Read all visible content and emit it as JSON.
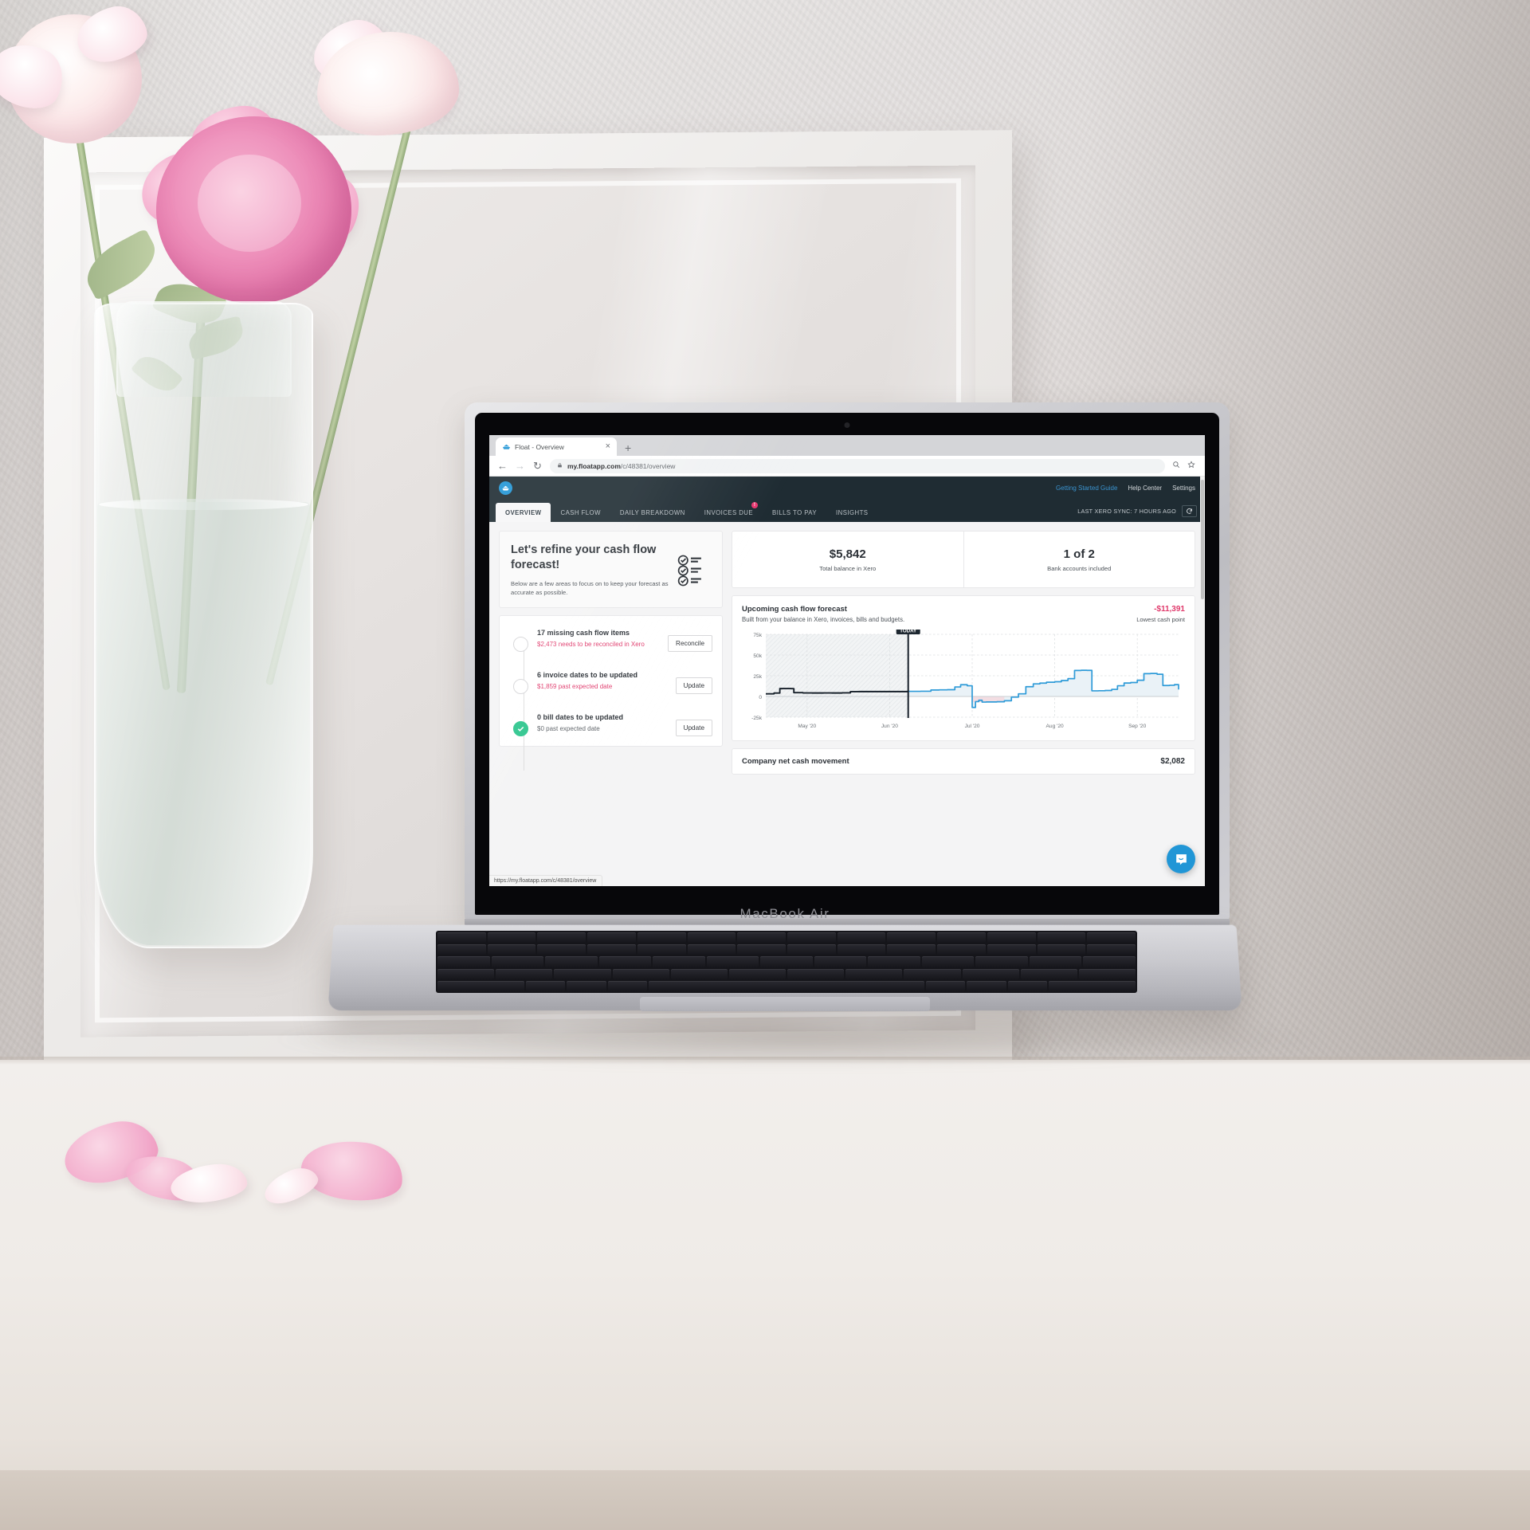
{
  "browser": {
    "tab_title": "Float - Overview",
    "tab_favicon": "float-logo-icon",
    "close_label": "×",
    "newtab_label": "+",
    "back_label": "←",
    "forward_label": "→",
    "reload_label": "↻",
    "lock_label": "🔒",
    "url_host": "my.floatapp.com",
    "url_path": "/c/48381/overview",
    "zoom_icon": "⊕",
    "star_icon": "☆",
    "status_url": "https://my.floatapp.com/c/48381/overview"
  },
  "header": {
    "logo": "float-boat-logo",
    "links": [
      {
        "label": "Getting Started Guide",
        "accent": true
      },
      {
        "label": "Help Center",
        "accent": false
      },
      {
        "label": "Settings",
        "accent": false
      }
    ]
  },
  "nav": {
    "tabs": [
      {
        "label": "OVERVIEW",
        "active": true,
        "badge": ""
      },
      {
        "label": "CASH FLOW",
        "active": false,
        "badge": ""
      },
      {
        "label": "DAILY BREAKDOWN",
        "active": false,
        "badge": ""
      },
      {
        "label": "INVOICES DUE",
        "active": false,
        "badge": "!"
      },
      {
        "label": "BILLS TO PAY",
        "active": false,
        "badge": ""
      },
      {
        "label": "INSIGHTS",
        "active": false,
        "badge": ""
      }
    ],
    "sync_text": "LAST XERO SYNC: 7 HOURS AGO",
    "sync_button_icon": "↻"
  },
  "refine": {
    "title": "Let's refine your cash flow forecast!",
    "subtitle": "Below are a few areas to focus on to keep your forecast as accurate as possible.",
    "icon": "checklist-icon"
  },
  "tasks": [
    {
      "title": "17 missing cash flow items",
      "sub": "$2,473 needs to be reconciled in Xero",
      "button": "Reconcile",
      "done": false,
      "muted": false
    },
    {
      "title": "6 invoice dates to be updated",
      "sub": "$1,859 past expected date",
      "button": "Update",
      "done": false,
      "muted": false
    },
    {
      "title": "0 bill dates to be updated",
      "sub": "$0 past expected date",
      "button": "Update",
      "done": true,
      "muted": true
    }
  ],
  "stats": [
    {
      "value": "$5,842",
      "label": "Total balance in Xero"
    },
    {
      "value": "1 of 2",
      "label": "Bank accounts included"
    }
  ],
  "forecast": {
    "title": "Upcoming cash flow forecast",
    "subtitle": "Built from your balance in Xero, invoices, bills and budgets.",
    "value": "-$11,391",
    "value_label": "Lowest cash point",
    "today_label": "TODAY"
  },
  "net_movement": {
    "title": "Company net cash movement",
    "value": "$2,082"
  },
  "intercom": {
    "icon": "chat-bubble-icon"
  },
  "colors": {
    "header_bg": "#1f2c33",
    "accent_blue": "#2196d6",
    "line_blue": "#2f9bd8",
    "alert_pink": "#e0396b",
    "success_green": "#27c48a"
  },
  "chart_data": {
    "type": "line",
    "title": "Upcoming cash flow forecast",
    "subtitle": "Built from your balance in Xero, invoices, bills and budgets.",
    "xlabel": "",
    "ylabel": "",
    "ylim": [
      -25000,
      75000
    ],
    "yticks": [
      75000,
      50000,
      25000,
      0,
      -25000
    ],
    "ytick_labels": [
      "75k",
      "50k",
      "25k",
      "0",
      "-25k"
    ],
    "xtick_labels": [
      "May '20",
      "Jun '20",
      "Jul '20",
      "Aug '20",
      "Sep '20"
    ],
    "grid": true,
    "legend": "none",
    "annotations": [
      {
        "label": "TODAY",
        "x_fraction": 0.345,
        "type": "vertical-marker"
      },
      {
        "label": "Lowest cash point",
        "value": -11391
      }
    ],
    "series": [
      {
        "name": "Actual (historic)",
        "color": "#17202a",
        "style": "solid",
        "x_fraction": [
          0.0,
          0.02,
          0.034,
          0.04,
          0.062,
          0.068,
          0.09,
          0.112,
          0.14,
          0.16,
          0.185,
          0.205,
          0.225,
          0.25,
          0.275,
          0.3,
          0.32,
          0.345
        ],
        "values": [
          3200,
          4100,
          9500,
          9600,
          9400,
          4600,
          4300,
          4200,
          4300,
          4200,
          4400,
          5800,
          5900,
          5900,
          5900,
          5900,
          5900,
          6200
        ]
      },
      {
        "name": "Forecast",
        "color": "#2f9bd8",
        "style": "solid",
        "fill": true,
        "x_fraction": [
          0.345,
          0.375,
          0.4,
          0.42,
          0.44,
          0.458,
          0.472,
          0.488,
          0.5,
          0.508,
          0.516,
          0.524,
          0.534,
          0.546,
          0.56,
          0.578,
          0.595,
          0.612,
          0.63,
          0.648,
          0.664,
          0.68,
          0.7,
          0.716,
          0.732,
          0.748,
          0.764,
          0.778,
          0.79,
          0.806,
          0.822,
          0.838,
          0.852,
          0.868,
          0.884,
          0.9,
          0.916,
          0.932,
          0.948,
          0.962,
          0.978,
          0.99,
          1.0
        ],
        "values": [
          6200,
          6300,
          7800,
          8000,
          8200,
          11500,
          14200,
          12900,
          -13200,
          -6200,
          -4600,
          -6800,
          -6600,
          -6600,
          -6400,
          -5200,
          -800,
          3200,
          11800,
          15200,
          16100,
          17200,
          17800,
          19200,
          21500,
          31400,
          31600,
          31500,
          6800,
          6900,
          7200,
          8600,
          12900,
          16200,
          16800,
          19600,
          27500,
          27800,
          26800,
          13200,
          13500,
          14300,
          8400
        ]
      }
    ]
  }
}
